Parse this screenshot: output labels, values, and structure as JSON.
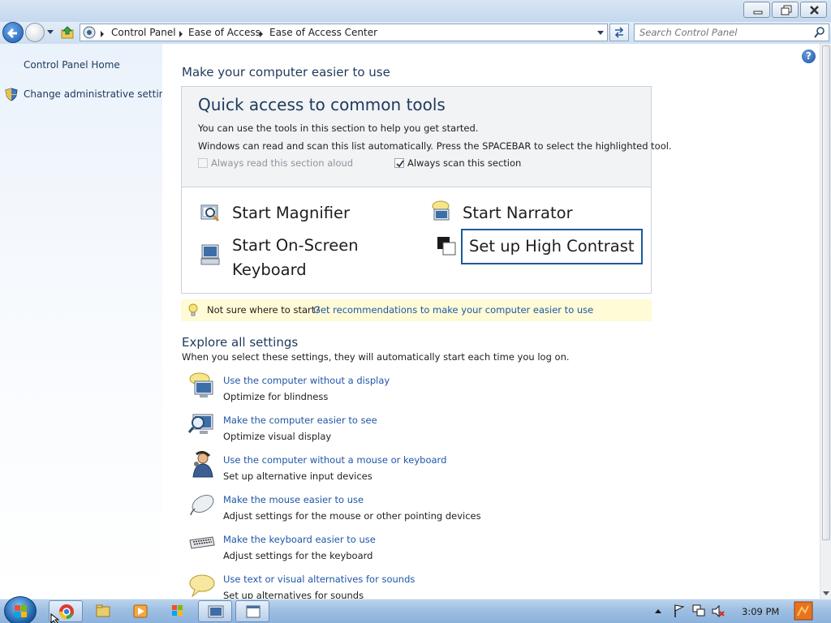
{
  "window": {
    "breadcrumb": [
      "Control Panel",
      "Ease of Access",
      "Ease of Access Center"
    ],
    "search_placeholder": "Search Control Panel",
    "help_label": "?"
  },
  "sidebar": {
    "home": "Control Panel Home",
    "admin": "Change administrative settings"
  },
  "main": {
    "heading": "Make your computer easier to use",
    "quick": {
      "title": "Quick access to common tools",
      "line1": "You can use the tools in this section to help you get started.",
      "line2": "Windows can read and scan this list automatically.  Press the SPACEBAR to select the highlighted tool.",
      "read_aloud": {
        "label": "Always read this section aloud",
        "checked": false,
        "enabled": false
      },
      "scan": {
        "label": "Always scan this section",
        "checked": true,
        "enabled": true
      },
      "tools": {
        "magnifier": "Start Magnifier",
        "narrator": "Start Narrator",
        "osk_line1": "Start On-Screen",
        "osk_line2": "Keyboard",
        "contrast": "Set up High Contrast"
      }
    },
    "hint": {
      "text": "Not sure where to start?",
      "link": "Get recommendations to make your computer easier to use"
    },
    "explore": {
      "title": "Explore all settings",
      "desc": "When you select these settings, they will automatically start each time you log on.",
      "items": [
        {
          "link": "Use the computer without a display",
          "desc": "Optimize for blindness",
          "icon": "monitor-speech-icon"
        },
        {
          "link": "Make the computer easier to see",
          "desc": "Optimize visual display",
          "icon": "monitor-magnifier-icon"
        },
        {
          "link": "Use the computer without a mouse or keyboard",
          "desc": "Set up alternative input devices",
          "icon": "person-icon"
        },
        {
          "link": "Make the mouse easier to use",
          "desc": "Adjust settings for the mouse or other pointing devices",
          "icon": "mouse-icon"
        },
        {
          "link": "Make the keyboard easier to use",
          "desc": "Adjust settings for the keyboard",
          "icon": "keyboard-icon"
        },
        {
          "link": "Use text or visual alternatives for sounds",
          "desc": "Set up alternatives for sounds",
          "icon": "speech-bubble-icon"
        }
      ]
    }
  },
  "taskbar": {
    "time": "3:09 PM",
    "buttons": [
      "chrome-icon",
      "folder-icon",
      "media-player-icon",
      "windows-flag-icon",
      "control-panel-icon",
      "window-icon"
    ]
  },
  "colors": {
    "link": "#1f56a8",
    "heading": "#1e395b",
    "focus_border": "#1b5a9d",
    "hint_bg": "#fefbd6"
  }
}
